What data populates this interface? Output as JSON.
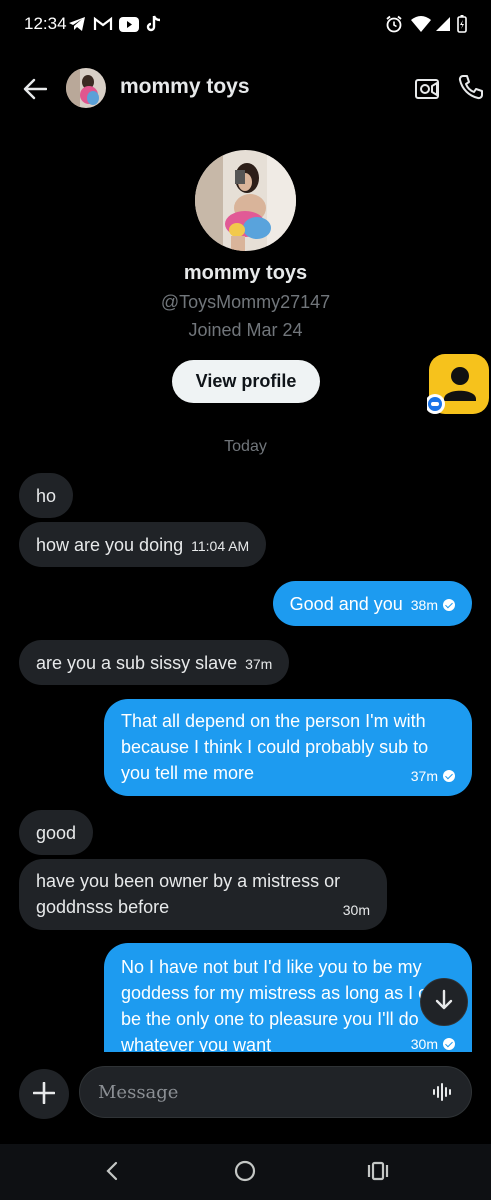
{
  "status_bar": {
    "time": "12:34"
  },
  "header": {
    "title": "mommy toys"
  },
  "profile": {
    "name": "mommy toys",
    "handle": "@ToysMommy27147",
    "joined": "Joined Mar 24",
    "view_profile_label": "View profile"
  },
  "date_divider": "Today",
  "messages": [
    {
      "text": "ho",
      "time": ""
    },
    {
      "text": "how are you doing",
      "time": "11:04 AM"
    },
    {
      "text": "Good and you",
      "time": "38m"
    },
    {
      "text": "are you a sub sissy slave",
      "time": "37m"
    },
    {
      "text": "That all depend on the person I'm with because I think I could probably sub to you tell me more",
      "time": "37m"
    },
    {
      "text": "good",
      "time": ""
    },
    {
      "text": "have you been owner by a mistress or goddnsss before",
      "time": "30m"
    },
    {
      "text": "No I have not but I'd like you to be my goddess for my mistress as long as I can be the only one to pleasure you I'll do whatever you want",
      "time": "30m"
    }
  ],
  "composer": {
    "placeholder": "Message"
  },
  "colors": {
    "accent": "#1d9bf0",
    "received_bubble": "#202327",
    "background": "#000000"
  },
  "icons": [
    "back-arrow-icon",
    "video-camera-icon",
    "phone-icon",
    "plus-icon",
    "voice-wave-icon",
    "arrow-down-icon"
  ]
}
